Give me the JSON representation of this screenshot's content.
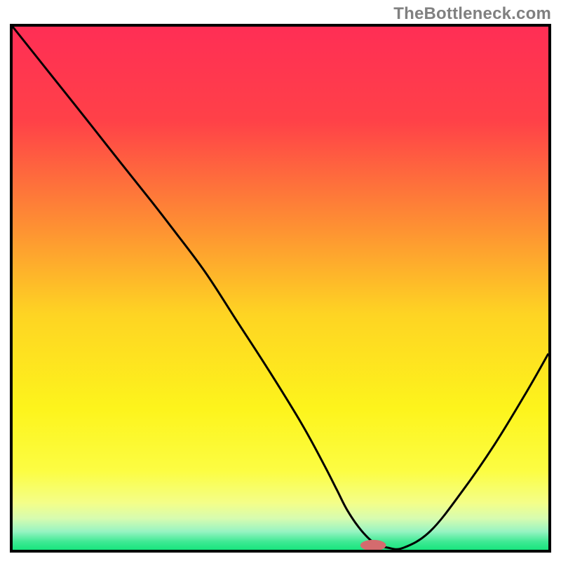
{
  "watermark": "TheBottleneck.com",
  "chart_data": {
    "type": "line",
    "title": "",
    "xlabel": "",
    "ylabel": "",
    "xlim": [
      0,
      100
    ],
    "ylim": [
      0,
      100
    ],
    "background_gradient": {
      "stops": [
        {
          "offset": 0.0,
          "color": "#ff2e55"
        },
        {
          "offset": 0.18,
          "color": "#ff4148"
        },
        {
          "offset": 0.38,
          "color": "#fe8f33"
        },
        {
          "offset": 0.55,
          "color": "#fed423"
        },
        {
          "offset": 0.73,
          "color": "#fdf41c"
        },
        {
          "offset": 0.85,
          "color": "#fcfd43"
        },
        {
          "offset": 0.91,
          "color": "#f4fe88"
        },
        {
          "offset": 0.94,
          "color": "#d7fcb0"
        },
        {
          "offset": 0.965,
          "color": "#97f4c2"
        },
        {
          "offset": 0.985,
          "color": "#3de993"
        },
        {
          "offset": 1.0,
          "color": "#18e57e"
        }
      ]
    },
    "series": [
      {
        "name": "bottleneck-curve",
        "color": "#000000",
        "x": [
          0.0,
          7,
          14,
          20,
          26,
          30,
          36,
          42,
          48,
          54,
          58,
          60.5,
          62.5,
          65,
          67.5,
          70,
          73,
          78,
          84,
          90,
          96,
          100
        ],
        "y": [
          100,
          91,
          82,
          74.2,
          66.5,
          61.2,
          53,
          43.5,
          34,
          24,
          16.5,
          11.5,
          7.5,
          3.8,
          1.3,
          0.4,
          0.4,
          3.6,
          11.3,
          20.2,
          30.3,
          37.5
        ]
      }
    ],
    "marker": {
      "name": "recommended-pill",
      "cx": 67.3,
      "cy": 0.85,
      "rx": 2.4,
      "ry": 1.05,
      "fill": "#d46b6e"
    },
    "legend": false,
    "grid": false
  }
}
